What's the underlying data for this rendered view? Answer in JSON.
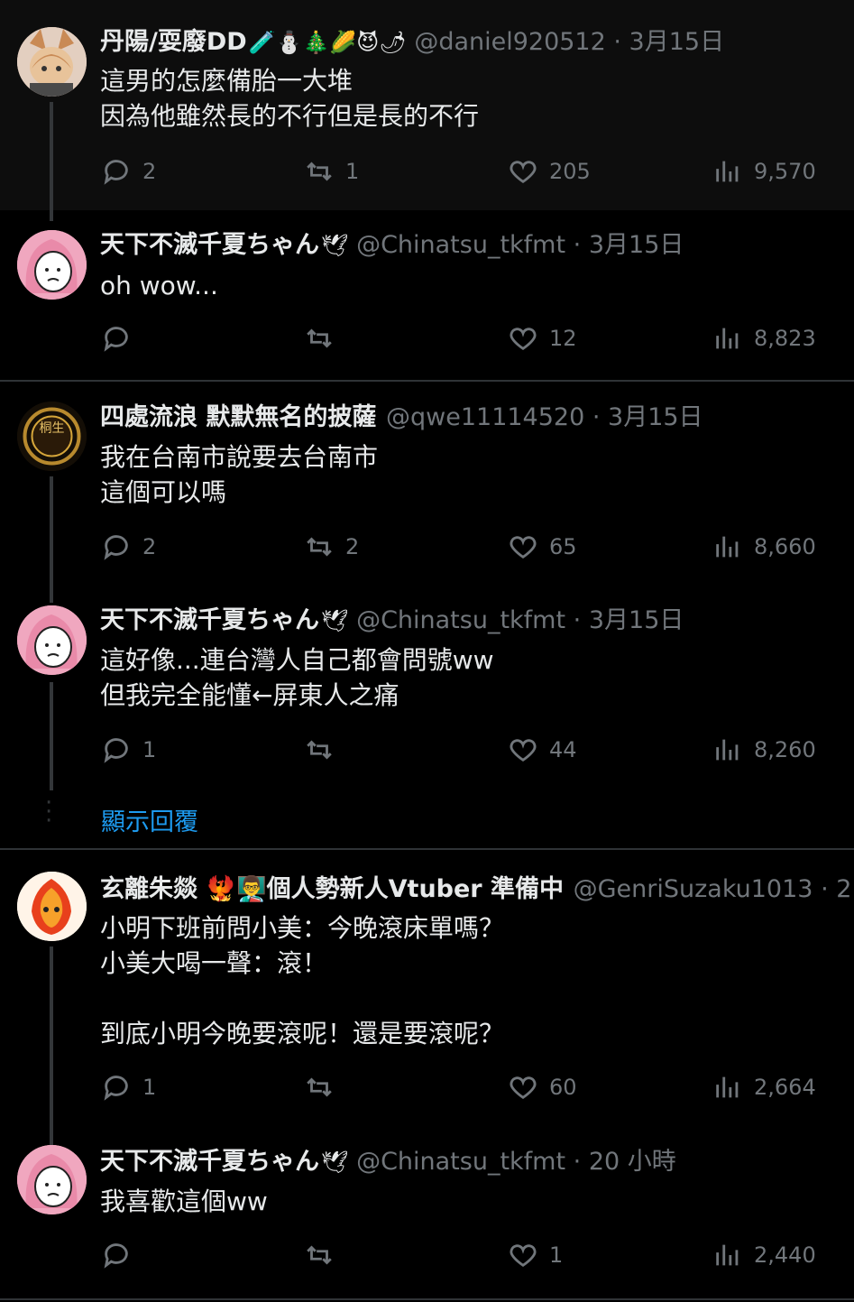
{
  "tweets": [
    {
      "name": "丹陽/耍廢DD",
      "emojis": "🧪⛄🎄🌽😈🌶",
      "handle": "@daniel920512",
      "time": "· 3月15日",
      "text": "這男的怎麼備胎一大堆\n因為他雖然長的不行但是長的不行",
      "replies": "2",
      "retweets": "1",
      "likes": "205",
      "views": "9,570"
    },
    {
      "name": "天下不滅千夏ちゃん",
      "emojis": "🕊",
      "handle": "@Chinatsu_tkfmt",
      "time": "· 3月15日",
      "text": "oh wow...",
      "replies": "",
      "retweets": "",
      "likes": "12",
      "views": "8,823"
    },
    {
      "name": "四處流浪 默默無名的披薩",
      "emojis": "",
      "handle": "@qwe11114520",
      "time": "· 3月15日",
      "text": "我在台南市說要去台南市\n這個可以嗎",
      "replies": "2",
      "retweets": "2",
      "likes": "65",
      "views": "8,660"
    },
    {
      "name": "天下不滅千夏ちゃん",
      "emojis": "🕊",
      "handle": "@Chinatsu_tkfmt",
      "time": "· 3月15日",
      "text": "這好像...連台灣人自己都會問號ww\n但我完全能懂←屏東人之痛",
      "replies": "1",
      "retweets": "",
      "likes": "44",
      "views": "8,260"
    },
    {
      "name": "玄離朱燚 🐦‍🔥👨‍🏫個人勢新人Vtuber 準備中",
      "emojis": "",
      "handle": "@GenriSuzaku1013",
      "time": "· 2",
      "text": "小明下班前問小美：今晚滾床單嗎？\n小美大喝一聲：滾！\n\n到底小明今晚要滾呢！還是要滾呢？",
      "replies": "1",
      "retweets": "",
      "likes": "60",
      "views": "2,664"
    },
    {
      "name": "天下不滅千夏ちゃん",
      "emojis": "🕊",
      "handle": "@Chinatsu_tkfmt",
      "time": "· 20 小時",
      "text": "我喜歡這個ww",
      "replies": "",
      "retweets": "",
      "likes": "1",
      "views": "2,440"
    }
  ],
  "show_replies_label": "顯示回覆",
  "avatar_badge_text": "桐生"
}
